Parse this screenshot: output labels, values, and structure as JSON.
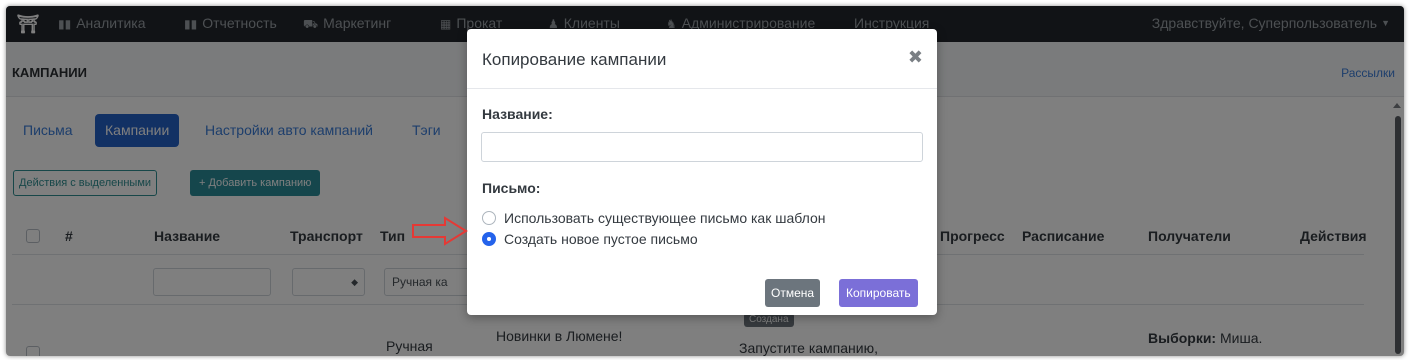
{
  "navbar": {
    "items": [
      {
        "icon": "bar-chart-icon",
        "label": "Аналитика"
      },
      {
        "icon": "bar-chart-icon",
        "label": "Отчетность"
      },
      {
        "icon": "cart-icon",
        "label": "Маркетинг"
      },
      {
        "icon": "grid-icon",
        "label": "Прокат"
      },
      {
        "icon": "users-icon",
        "label": "Клиенты"
      },
      {
        "icon": "admin-icon",
        "label": "Администрирование"
      },
      {
        "label": "Инструкция"
      }
    ],
    "greeting": "Здравствуйте, Суперпользователь"
  },
  "breadcrumb": {
    "title": "КАМПАНИИ",
    "right_link": "Рассылки"
  },
  "tabs": [
    "Письма",
    "Кампании",
    "Настройки авто кампаний",
    "Тэги"
  ],
  "active_tab": "Кампании",
  "toolbar": {
    "bulk_actions": "Действия с выделенными",
    "add_campaign": "+ Добавить кампанию"
  },
  "table": {
    "headers": {
      "id": "#",
      "name": "Название",
      "transport": "Транспорт",
      "type": "Тип",
      "progress": "Прогресс",
      "schedule": "Расписание",
      "recipients": "Получатели",
      "actions": "Действия"
    },
    "filters": {
      "type_selected": "Ручная ка"
    },
    "row": {
      "type": "Ручная",
      "letter": "Новинки в Люмене!",
      "status_badge": "Создана",
      "status_text": "Запустите кампанию,",
      "recipients_label": "Выборки:",
      "recipients_value": "Миша."
    }
  },
  "modal": {
    "title": "Копирование кампании",
    "close_symbol": "✖",
    "name_label": "Название:",
    "name_value": "",
    "letter_label": "Письмо:",
    "options": [
      "Использовать существующее письмо как шаблон",
      "Создать новое пустое письмо"
    ],
    "selected_option_index": 1,
    "cancel": "Отмена",
    "copy": "Копировать"
  },
  "colors": {
    "navbar_bg": "#22272c",
    "primary": "#2563c8",
    "copy_button": "#7b6fd8",
    "annotation_arrow": "#e53935"
  }
}
